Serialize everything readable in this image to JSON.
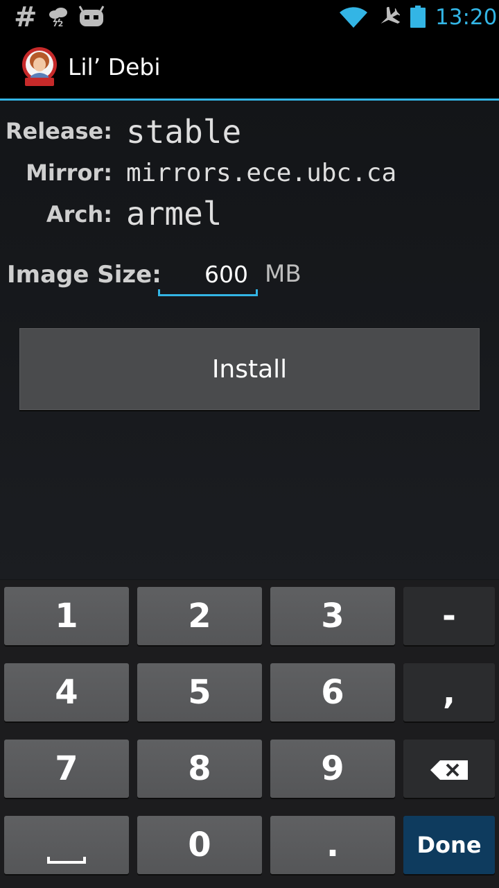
{
  "status_bar": {
    "hash_icon": "hash-icon",
    "weather_temp": "72",
    "time": "13:20",
    "icons": [
      "hash-icon",
      "weather-icon",
      "cyanogenmod-icon",
      "wifi-icon",
      "airplane-icon",
      "battery-icon"
    ]
  },
  "action_bar": {
    "title": "Lil’ Debi",
    "icon": "lil-debi-logo-icon"
  },
  "form": {
    "release_label": "Release:",
    "release_value": "stable",
    "mirror_label": "Mirror:",
    "mirror_value": "mirrors.ece.ubc.ca",
    "arch_label": "Arch:",
    "arch_value": "armel",
    "image_size_label": "Image Size:",
    "image_size_value": "600",
    "image_size_unit": "MB"
  },
  "install_button": {
    "label": "Install"
  },
  "keyboard": {
    "keys": [
      "1",
      "2",
      "3",
      "-",
      "4",
      "5",
      "6",
      ",",
      "7",
      "8",
      "9",
      "⌫",
      "␣",
      "0",
      ".",
      "Done"
    ],
    "row1": [
      "1",
      "2",
      "3",
      "-"
    ],
    "row2": [
      "4",
      "5",
      "6",
      ","
    ],
    "row3": [
      "7",
      "8",
      "9"
    ],
    "zero": "0",
    "dot": ".",
    "done": "Done"
  },
  "colors": {
    "accent": "#33b5e5",
    "background": "#131518",
    "done_key": "#0e3b5e"
  }
}
